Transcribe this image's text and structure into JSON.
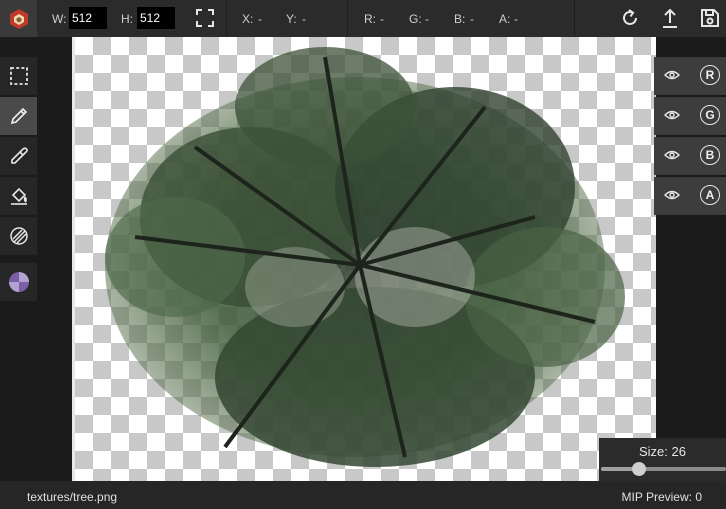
{
  "toolbar": {
    "width_label": "W:",
    "width_value": "512",
    "height_label": "H:",
    "height_value": "512",
    "x_label": "X:",
    "x_value": "-",
    "y_label": "Y:",
    "y_value": "-",
    "r_label": "R:",
    "r_value": "-",
    "g_label": "G:",
    "g_value": "-",
    "b_label": "B:",
    "b_value": "-",
    "a_label": "A:",
    "a_value": "-"
  },
  "left_tools": [
    {
      "name": "selection-icon",
      "active": false
    },
    {
      "name": "pencil-icon",
      "active": true
    },
    {
      "name": "eyedropper-icon",
      "active": false
    },
    {
      "name": "paint-bucket-icon",
      "active": false
    },
    {
      "name": "pattern-icon",
      "active": false
    },
    {
      "name": "color-swatch-icon",
      "active": false
    }
  ],
  "channels": [
    {
      "letter": "R",
      "icon": "eye-icon"
    },
    {
      "letter": "G",
      "icon": "eye-icon"
    },
    {
      "letter": "B",
      "icon": "eye-icon"
    },
    {
      "letter": "A",
      "icon": "eye-icon"
    }
  ],
  "brush": {
    "size_text": "Size: 26",
    "slider_fraction": 0.3
  },
  "status": {
    "file_path": "textures/tree.png",
    "mip_preview": "MIP Preview: 0"
  },
  "colors": {
    "accent_logo": "#c0392b",
    "swatch_purple": "#7b5ea7"
  }
}
